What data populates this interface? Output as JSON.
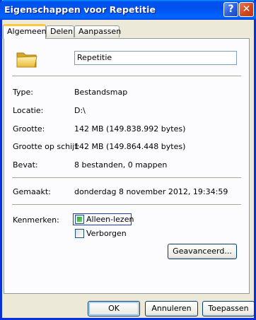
{
  "window": {
    "title": "Eigenschappen voor Repetitie",
    "help_button": "?",
    "close_button": "✕"
  },
  "tabs": [
    {
      "label": "Algemeen",
      "active": true
    },
    {
      "label": "Delen",
      "active": false
    },
    {
      "label": "Aanpassen",
      "active": false
    }
  ],
  "general": {
    "icon": "folder-icon",
    "name_value": "Repetitie",
    "properties": [
      {
        "label": "Type:",
        "value": "Bestandsmap"
      },
      {
        "label": "Locatie:",
        "value": "D:\\"
      },
      {
        "label": "Grootte:",
        "value": "142 MB (149.838.992 bytes)"
      },
      {
        "label": "Grootte op schijf:",
        "value": "142 MB (149.864.448 bytes)"
      },
      {
        "label": "Bevat:",
        "value": "8 bestanden, 0 mappen"
      }
    ],
    "created": {
      "label": "Gemaakt:",
      "value": "donderdag 8 november 2012, 19:34:59"
    },
    "attributes": {
      "label": "Kenmerken:",
      "readonly": {
        "label": "Alleen-lezen",
        "state": "indeterminate"
      },
      "hidden": {
        "label": "Verborgen",
        "state": "unchecked"
      },
      "advanced_button": "Geavanceerd..."
    }
  },
  "buttons": {
    "ok": "OK",
    "cancel": "Annuleren",
    "apply": "Toepassen"
  },
  "colors": {
    "titlebar": "#0054E3",
    "face": "#ECE9D8",
    "panel": "#FCFCFE",
    "active_tab_accent": "#FFC83C"
  }
}
